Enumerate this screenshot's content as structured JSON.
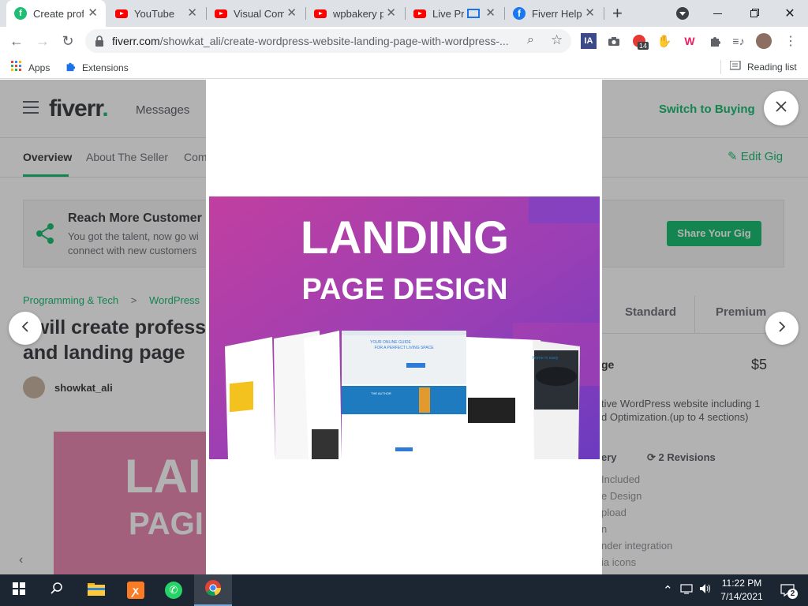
{
  "browser": {
    "tabs": [
      {
        "title": "Create prof",
        "favicon": "fiverr-icon",
        "active": true
      },
      {
        "title": "YouTube",
        "favicon": "youtube-icon"
      },
      {
        "title": "Visual Comp",
        "favicon": "youtube-icon"
      },
      {
        "title": "wpbakery p",
        "favicon": "youtube-icon"
      },
      {
        "title": "Live Pro",
        "favicon": "youtube-icon"
      },
      {
        "title": "Fiverr Help",
        "favicon": "facebook-icon"
      }
    ],
    "new_tab": "+",
    "url_host": "fiverr.com",
    "url_path": "/showkat_ali/create-wordpress-website-landing-page-with-wordpress-...",
    "extensions": [
      "IA",
      "14"
    ],
    "bookmarks": {
      "apps": "Apps",
      "extensions": "Extensions",
      "reading_list": "Reading list"
    }
  },
  "page": {
    "logo": "fiverr",
    "logo_dot": ".",
    "messages": "Messages",
    "switch_to_buying": "Switch to Buying",
    "tabs": [
      "Overview",
      "About The Seller",
      "Com"
    ],
    "edit_gig": "Edit Gig",
    "reach": {
      "title": "Reach More Customer",
      "line1": "You got the talent, now go wi",
      "line2": "connect with new customers",
      "button": "Share Your Gig"
    },
    "breadcrumb": [
      "Programming & Tech",
      ">",
      "WordPress"
    ],
    "gig_title": "I will create profess and landing page",
    "seller": "showkat_ali",
    "gig_image_text": [
      "LAI",
      "PAGI"
    ],
    "packages": {
      "headers": [
        "Standard",
        "Premium"
      ],
      "name": "ge",
      "price": "$5",
      "desc1": "tive WordPress website including 1",
      "desc2": "d Optimization.(up to 4 sections)",
      "delivery": "ery",
      "revisions": "2 Revisions",
      "features": [
        "Included",
        "e Design",
        "pload",
        "n",
        "nder integration",
        "ia icons"
      ]
    }
  },
  "modal": {
    "image_line1": "LANDING",
    "image_line2": "PAGE DESIGN",
    "mock_text": [
      "YOUR ONLINE GUIDE",
      "FOR A PERFECT LIVING SPACE",
      "THE AUTHOR",
      "home is easy"
    ]
  },
  "taskbar": {
    "time": "11:22 PM",
    "date": "7/14/2021",
    "notifications": "2"
  },
  "colors": {
    "fiverr_green": "#1dbf73",
    "youtube_red": "#ff0000",
    "facebook_blue": "#1877f2",
    "taskbar": "#1c2633"
  }
}
